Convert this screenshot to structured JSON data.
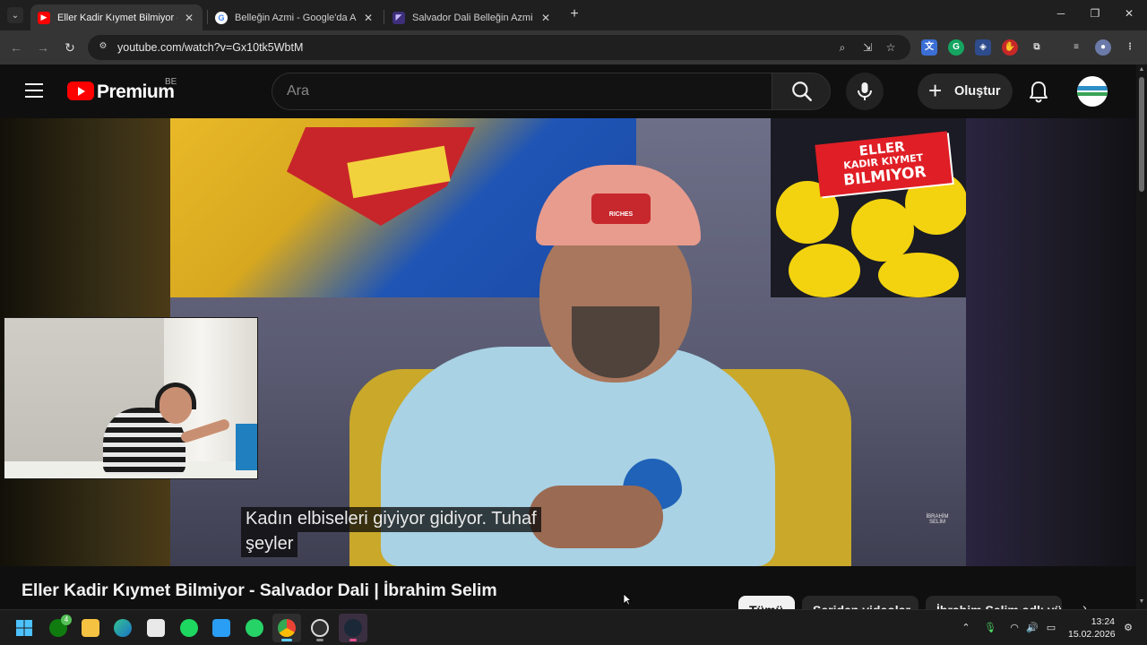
{
  "browser": {
    "tabs": [
      {
        "title": "Eller Kadir Kıymet Bilmiyor - Sal",
        "active": true,
        "favicon": "youtube-icon"
      },
      {
        "title": "Belleğin Azmi - Google'da Ara",
        "active": false,
        "favicon": "google-icon"
      },
      {
        "title": "Salvador Dali Belleğin Azmi Tab",
        "active": false,
        "favicon": "site-icon"
      }
    ],
    "close_glyph": "✕",
    "new_tab_glyph": "+",
    "address_url": "youtube.com/watch?v=Gx10tk5WbtM"
  },
  "youtube": {
    "brand": "Premium",
    "country_code": "BE",
    "search_placeholder": "Ara",
    "create_label": "Oluştur"
  },
  "player": {
    "caption_line1": "Kadın elbiseleri giyiyor gidiyor. Tuhaf",
    "caption_line2": "şeyler",
    "badge_line1": "ELLER",
    "badge_line2": "KADIR KIYMET",
    "badge_line3": "BILMIYOR",
    "cap_text": "RICHES",
    "watermark": "İBRAHİM SELİM"
  },
  "video": {
    "title": "Eller Kadir Kıymet Bilmiyor - Salvador Dali | İbrahim Selim",
    "chips": [
      "Tümü",
      "Seriden videolar",
      "İbrahim Selim adlı yü"
    ]
  },
  "taskbar": {
    "time": "13:24",
    "date": "15.02.2026",
    "xbox_badge": "4"
  },
  "colors": {
    "youtube_red": "#ff0000",
    "accent_blue": "#60cdff",
    "badge_red": "#e01e25"
  }
}
